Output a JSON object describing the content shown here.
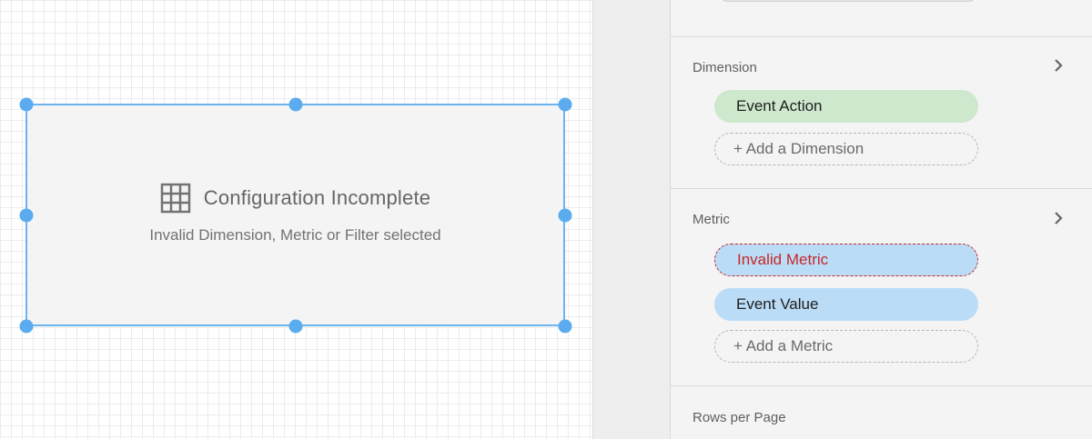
{
  "canvas": {
    "chart": {
      "icon": "table-grid-icon",
      "title": "Configuration Incomplete",
      "subtitle": "Invalid Dimension, Metric or Filter selected"
    },
    "colors": {
      "selection": "#6ab4ef",
      "grid": "#ececec"
    }
  },
  "panel": {
    "dimension": {
      "label": "Dimension",
      "items": [
        {
          "label": "Event Action",
          "state": "valid"
        }
      ],
      "add_label": "+ Add a Dimension"
    },
    "metric": {
      "label": "Metric",
      "items": [
        {
          "label": "Invalid Metric",
          "state": "invalid"
        },
        {
          "label": "Event Value",
          "state": "valid"
        }
      ],
      "add_label": "+ Add a Metric"
    },
    "rows_per_page": {
      "label": "Rows per Page"
    },
    "colors": {
      "dimension_pill": "#cde8cd",
      "metric_pill": "#bbdcf7",
      "invalid": "#c62828"
    }
  }
}
